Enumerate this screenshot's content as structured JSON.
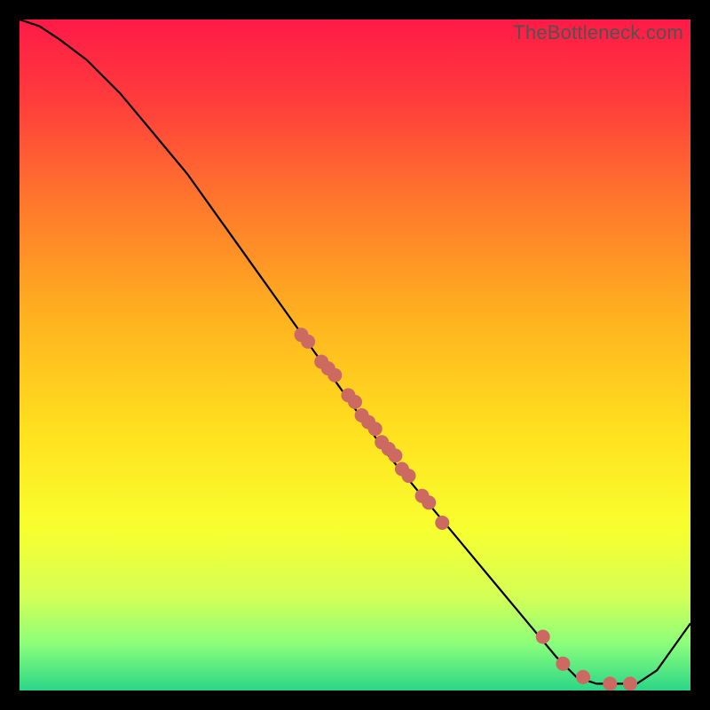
{
  "watermark": "TheBottleneck.com",
  "colors": {
    "frame": "#000000",
    "curve": "#000000",
    "point": "#cc6a62",
    "gradient_stops": [
      {
        "offset": 0.0,
        "hex": "#ff1a47"
      },
      {
        "offset": 0.12,
        "hex": "#ff3c3c"
      },
      {
        "offset": 0.28,
        "hex": "#ff7a2b"
      },
      {
        "offset": 0.45,
        "hex": "#ffb41f"
      },
      {
        "offset": 0.62,
        "hex": "#ffe21f"
      },
      {
        "offset": 0.76,
        "hex": "#f8ff2f"
      },
      {
        "offset": 0.86,
        "hex": "#d4ff55"
      },
      {
        "offset": 0.93,
        "hex": "#8cff7a"
      },
      {
        "offset": 1.0,
        "hex": "#2bd688"
      }
    ]
  },
  "chart_data": {
    "type": "line",
    "title": "",
    "xlabel": "",
    "ylabel": "",
    "xlim": [
      0,
      100
    ],
    "ylim": [
      0,
      100
    ],
    "series": [
      {
        "name": "bottleneck-curve",
        "x": [
          0,
          3,
          6,
          10,
          15,
          20,
          25,
          30,
          35,
          40,
          45,
          50,
          55,
          60,
          65,
          70,
          75,
          80,
          83,
          86,
          89,
          92,
          95,
          100
        ],
        "y": [
          100,
          99,
          97,
          94,
          89,
          83,
          77,
          70,
          63,
          56,
          49,
          42,
          35,
          29,
          23,
          17,
          11,
          5,
          2,
          1,
          1,
          1,
          3,
          10
        ]
      }
    ],
    "scatter": {
      "name": "highlighted-points",
      "points": [
        {
          "x": 42,
          "y": 53
        },
        {
          "x": 43,
          "y": 52
        },
        {
          "x": 45,
          "y": 49
        },
        {
          "x": 46,
          "y": 48
        },
        {
          "x": 47,
          "y": 47
        },
        {
          "x": 49,
          "y": 44
        },
        {
          "x": 50,
          "y": 43
        },
        {
          "x": 51,
          "y": 41
        },
        {
          "x": 52,
          "y": 40
        },
        {
          "x": 53,
          "y": 39
        },
        {
          "x": 54,
          "y": 37
        },
        {
          "x": 55,
          "y": 36
        },
        {
          "x": 56,
          "y": 35
        },
        {
          "x": 57,
          "y": 33
        },
        {
          "x": 58,
          "y": 32
        },
        {
          "x": 60,
          "y": 29
        },
        {
          "x": 61,
          "y": 28
        },
        {
          "x": 63,
          "y": 25
        },
        {
          "x": 78,
          "y": 8
        },
        {
          "x": 81,
          "y": 4
        },
        {
          "x": 84,
          "y": 2
        },
        {
          "x": 88,
          "y": 1
        },
        {
          "x": 91,
          "y": 1
        }
      ],
      "radius": 8
    }
  }
}
